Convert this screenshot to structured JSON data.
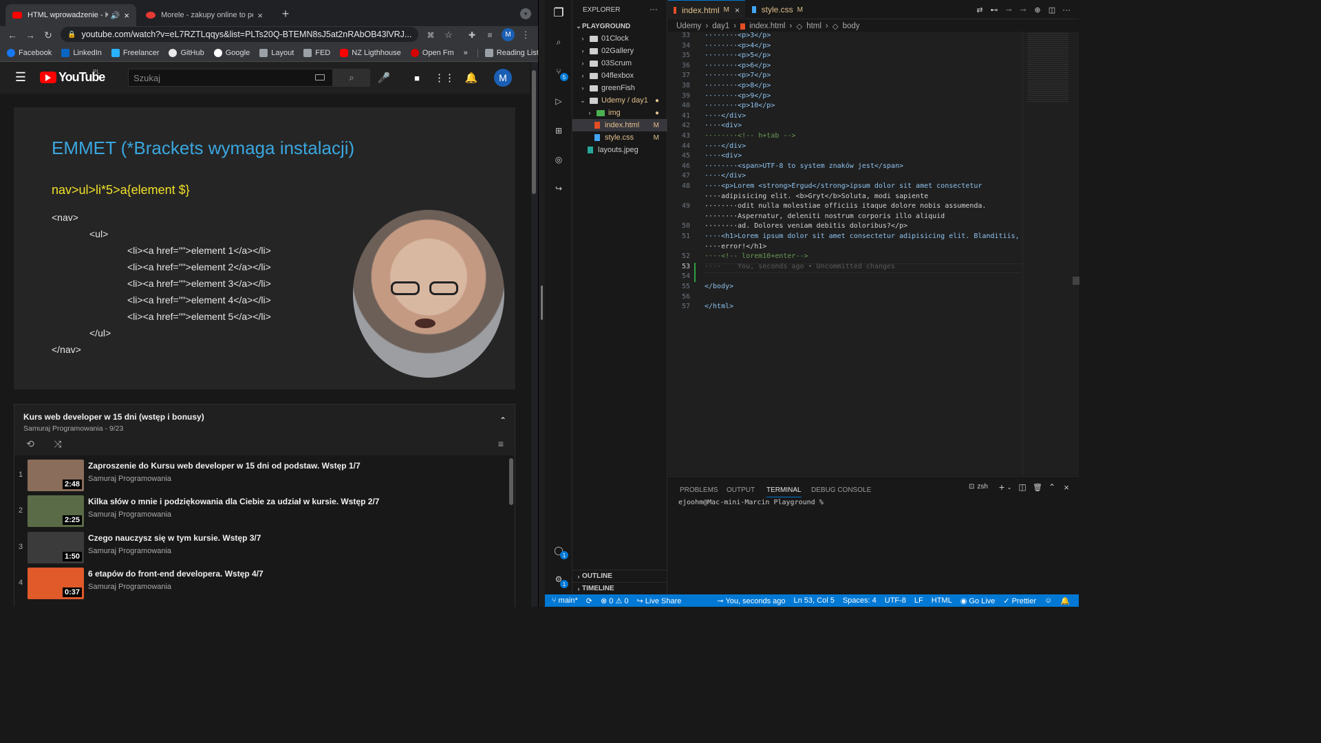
{
  "browser": {
    "tabs": [
      {
        "label": "HTML wprowadzenie - Kur"
      },
      {
        "label": "Morele - zakupy online to pest"
      }
    ],
    "new_tab": "+",
    "url": "youtube.com/watch?v=eL7RZTLqqys&list=PLTs20Q-BTEMN8sJ5at2nRAbOB43lVRJ...",
    "profile": "M",
    "bookmarks": [
      "Facebook",
      "LinkedIn",
      "Freelancer",
      "GitHub",
      "Google",
      "Layout",
      "FED",
      "NZ Ligthhouse",
      "Open Fm"
    ],
    "more": "»",
    "reading_list": "Reading List"
  },
  "youtube": {
    "logo": "YouTube",
    "region": "PL",
    "search_placeholder": "Szukaj",
    "avatar": "M",
    "slide": {
      "title": "EMMET (*Brackets wymaga instalacji)",
      "subtitle": "nav>ul>li*5>a{element $}",
      "code": [
        "<nav>",
        "<ul>",
        "<li><a href=\"\">element 1</a></li>",
        "<li><a href=\"\">element 2</a></li>",
        "<li><a href=\"\">element 3</a></li>",
        "<li><a href=\"\">element 4</a></li>",
        "<li><a href=\"\">element 5</a></li>",
        "</ul>",
        "</nav>"
      ]
    },
    "playlist": {
      "title": "Kurs web developer w 15 dni (wstęp i bonusy)",
      "meta": "Samuraj Programowania - 9/23",
      "items": [
        {
          "num": "1",
          "title": "Zaproszenie do Kursu web developer w 15 dni od podstaw. Wstęp 1/7",
          "channel": "Samuraj Programowania",
          "duration": "2:48",
          "color": "#8a6d5a"
        },
        {
          "num": "2",
          "title": "Kilka słów o mnie i podziękowania dla Ciebie za udział w kursie. Wstęp 2/7",
          "channel": "Samuraj Programowania",
          "duration": "2:25",
          "color": "#5a6b47"
        },
        {
          "num": "3",
          "title": "Czego nauczysz się w tym kursie. Wstęp 3/7",
          "channel": "Samuraj Programowania",
          "duration": "1:50",
          "color": "#3b3b3b"
        },
        {
          "num": "4",
          "title": "6 etapów do front-end developera. Wstęp 4/7",
          "channel": "Samuraj Programowania",
          "duration": "0:37",
          "color": "#e05a2a"
        }
      ]
    }
  },
  "vscode": {
    "explorer_label": "EXPLORER",
    "workspace": "PLAYGROUND",
    "tree": [
      {
        "label": "01Clock",
        "kind": "folder",
        "level": 0,
        "badge": ""
      },
      {
        "label": "02Gallery",
        "kind": "folder",
        "level": 0,
        "badge": ""
      },
      {
        "label": "03Scrum",
        "kind": "folder",
        "level": 0,
        "badge": ""
      },
      {
        "label": "04flexbox",
        "kind": "folder",
        "level": 0,
        "badge": ""
      },
      {
        "label": "greenFish",
        "kind": "folder",
        "level": 0,
        "badge": ""
      },
      {
        "label": "Udemy / day1",
        "kind": "folder-open",
        "level": 0,
        "badge": "●"
      },
      {
        "label": "img",
        "kind": "folder",
        "level": 1,
        "badge": "●"
      },
      {
        "label": "index.html",
        "kind": "file",
        "level": 1,
        "badge": "M"
      },
      {
        "label": "style.css",
        "kind": "file",
        "level": 1,
        "badge": "M"
      },
      {
        "label": "layouts.jpeg",
        "kind": "file",
        "level": 0,
        "badge": ""
      }
    ],
    "outline": "OUTLINE",
    "timeline": "TIMELINE",
    "editor_tabs": [
      {
        "label": "index.html",
        "badge": "M"
      },
      {
        "label": "style.css",
        "badge": "M"
      }
    ],
    "breadcrumbs": [
      "Udemy",
      "day1",
      "index.html",
      "html",
      "body"
    ],
    "code": [
      {
        "n": "33",
        "t": "········<p>3</p>"
      },
      {
        "n": "34",
        "t": "········<p>4</p>"
      },
      {
        "n": "35",
        "t": "········<p>5</p>"
      },
      {
        "n": "36",
        "t": "········<p>6</p>"
      },
      {
        "n": "37",
        "t": "········<p>7</p>"
      },
      {
        "n": "38",
        "t": "········<p>8</p>"
      },
      {
        "n": "39",
        "t": "········<p>9</p>"
      },
      {
        "n": "40",
        "t": "········<p>10</p>"
      },
      {
        "n": "41",
        "t": "····</div>"
      },
      {
        "n": "42",
        "t": "····<div>"
      },
      {
        "n": "43",
        "t": "········<!-- h+tab -->"
      },
      {
        "n": "44",
        "t": "····</div>"
      },
      {
        "n": "45",
        "t": "····<div>"
      },
      {
        "n": "46",
        "t": "········<span>UTF-8 to system znaków jest</span>"
      },
      {
        "n": "47",
        "t": "····</div>"
      },
      {
        "n": "48",
        "t": "····<p>Lorem <strong>Ergud</strong>ipsum dolor sit amet consectetur"
      },
      {
        "n": "",
        "t": "····adipisicing elit. <b>Gryt</b>Soluta, modi sapiente"
      },
      {
        "n": "49",
        "t": "········odit nulla molestiae officiis itaque dolore nobis assumenda."
      },
      {
        "n": "",
        "t": "········Aspernatur, deleniti nostrum corporis illo aliquid"
      },
      {
        "n": "50",
        "t": "········ad. Dolores veniam debitis doloribus?</p>"
      },
      {
        "n": "51",
        "t": "····<h1>Lorem ipsum dolor sit amet consectetur adipisicing elit. Blanditiis,"
      },
      {
        "n": "",
        "t": "····error!</h1>"
      },
      {
        "n": "52",
        "t": "····<!-- lorem10+enter-->"
      },
      {
        "n": "53",
        "t": "····    You, seconds ago • Uncommitted changes"
      },
      {
        "n": "54",
        "t": ""
      },
      {
        "n": "55",
        "t": "</body>"
      },
      {
        "n": "56",
        "t": ""
      },
      {
        "n": "57",
        "t": "</html>"
      }
    ],
    "panel_tabs": [
      "PROBLEMS",
      "OUTPUT",
      "TERMINAL",
      "DEBUG CONSOLE"
    ],
    "shell": "zsh",
    "terminal_prompt": "ejoohm@Mac-mini-Marcin Playground %",
    "status": {
      "branch": "main*",
      "problems": "⊗ 0 ⚠ 0",
      "liveshare": "Live Share",
      "blame": "You, seconds ago",
      "position": "Ln 53, Col 5",
      "spaces": "Spaces: 4",
      "encoding": "UTF-8",
      "eol": "LF",
      "language": "HTML",
      "golive": "Go Live",
      "prettier": "Prettier"
    },
    "activity_badges": {
      "scm": "5",
      "accounts": "1",
      "settings": "1"
    }
  }
}
